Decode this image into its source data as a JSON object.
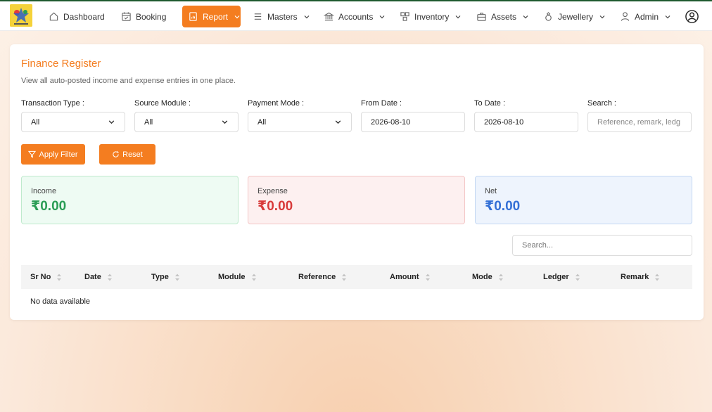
{
  "nav": {
    "items": [
      {
        "label": "Dashboard",
        "icon": "home-icon"
      },
      {
        "label": "Booking",
        "icon": "calendar-icon"
      },
      {
        "label": "Report",
        "icon": "report-icon",
        "active": true
      },
      {
        "label": "Masters",
        "icon": "menu-lines-icon"
      },
      {
        "label": "Accounts",
        "icon": "bank-icon"
      },
      {
        "label": "Inventory",
        "icon": "boxes-icon"
      },
      {
        "label": "Assets",
        "icon": "briefcase-icon"
      },
      {
        "label": "Jewellery",
        "icon": "ring-icon"
      },
      {
        "label": "Admin",
        "icon": "user-icon"
      }
    ],
    "profile_icon": "profile-circle-icon"
  },
  "page": {
    "title": "Finance Register",
    "subtitle": "View all auto-posted income and expense entries in one place."
  },
  "filters": {
    "transaction_type": {
      "label": "Transaction Type :",
      "value": "All"
    },
    "source_module": {
      "label": "Source Module :",
      "value": "All"
    },
    "payment_mode": {
      "label": "Payment Mode :",
      "value": "All"
    },
    "from_date": {
      "label": "From Date :",
      "value": "2026-08-10"
    },
    "to_date": {
      "label": "To Date :",
      "value": "2026-08-10"
    },
    "search": {
      "label": "Search :",
      "placeholder": "Reference, remark, ledg"
    }
  },
  "buttons": {
    "apply": "Apply Filter",
    "reset": "Reset"
  },
  "summary": {
    "income": {
      "label": "Income",
      "value": "₹0.00"
    },
    "expense": {
      "label": "Expense",
      "value": "₹0.00"
    },
    "net": {
      "label": "Net",
      "value": "₹0.00"
    }
  },
  "table": {
    "search_placeholder": "Search...",
    "columns": [
      "Sr No",
      "Date",
      "Type",
      "Module",
      "Reference",
      "Amount",
      "Mode",
      "Ledger",
      "Remark"
    ],
    "empty_text": "No data available"
  },
  "colors": {
    "accent": "#f47d20",
    "income": "#2a9d55",
    "expense": "#d83a3a",
    "net": "#3470d6"
  }
}
